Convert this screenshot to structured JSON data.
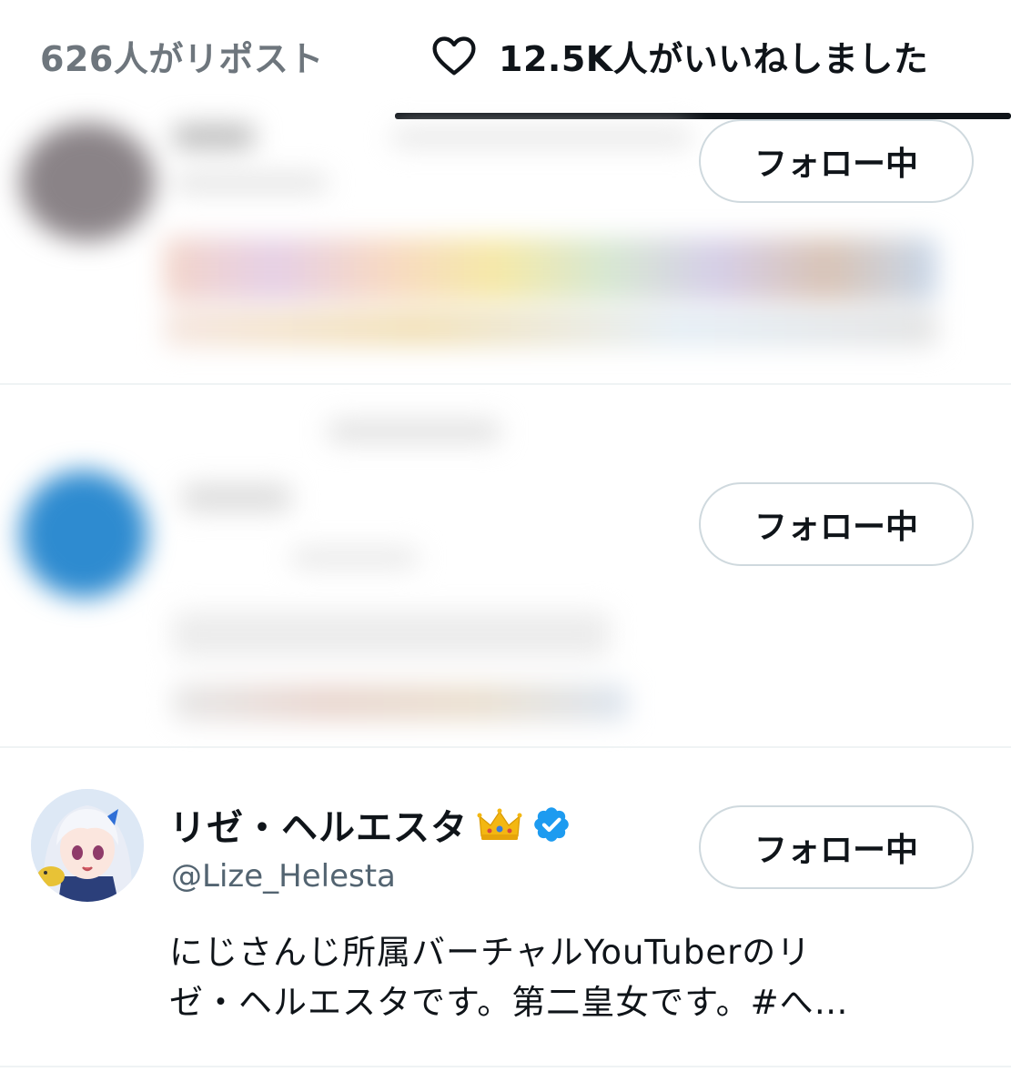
{
  "tabs": {
    "reposts_label": "626人がリポスト",
    "likes_label": "12.5K人がいいねしました",
    "active": "likes"
  },
  "icons": {
    "tab_heart": "heart-outline-icon",
    "crown": "crown-icon",
    "verified": "verified-badge-icon"
  },
  "colors": {
    "text_primary": "#0f1419",
    "text_secondary": "#536471",
    "verified_blue": "#1d9bf0",
    "border": "#cfd9de"
  },
  "users": [
    {
      "follow_label": "フォロー中"
    },
    {
      "follow_label": "フォロー中"
    },
    {
      "display_name": "リゼ・ヘルエスタ",
      "handle": "@Lize_Helesta",
      "bio_line1": "にじさんじ所属バーチャルYouTuberのリ",
      "bio_line2": "ゼ・ヘルエスタです。第二皇女です。#へ…",
      "follow_label": "フォロー中"
    }
  ]
}
